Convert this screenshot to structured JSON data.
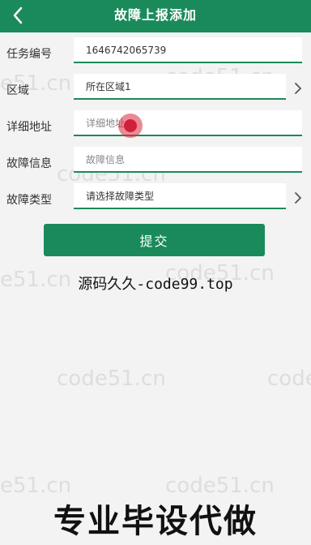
{
  "header": {
    "title": "故障上报添加",
    "back_icon": "chevron-left-icon"
  },
  "form": {
    "task_no": {
      "label": "任务编号",
      "value": "1646742065739"
    },
    "region": {
      "label": "区域",
      "value": "所在区域1"
    },
    "address": {
      "label": "详细地址",
      "placeholder": "详细地址"
    },
    "fault_info": {
      "label": "故障信息",
      "placeholder": "故障信息"
    },
    "fault_type": {
      "label": "故障类型",
      "value": "请选择故障类型"
    }
  },
  "submit_label": "提交",
  "watermark": {
    "caption": "源码久久-code99.top",
    "repeat": "code51.cn",
    "left_fragment": "e51.cn",
    "banner": "专业毕设代做"
  },
  "colors": {
    "primary": "#1a8a5a",
    "background": "#f3f3f3"
  }
}
